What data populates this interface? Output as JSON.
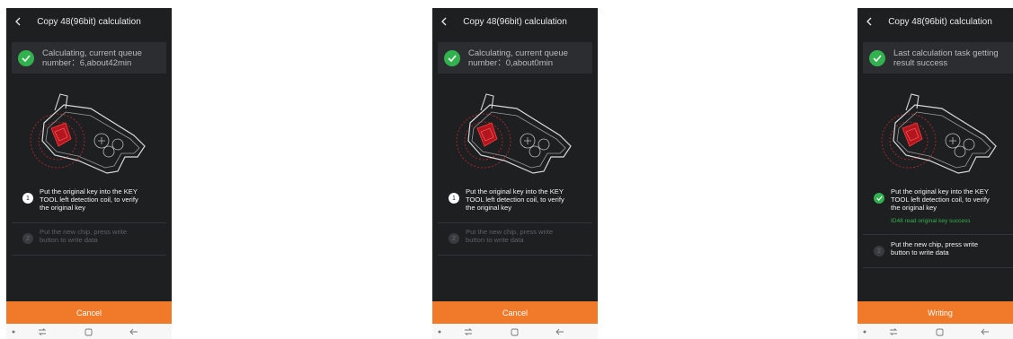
{
  "screens": [
    {
      "title": "Copy 48(96bit) calculation",
      "status": [
        "Calculating, current queue",
        "number：6,about42min"
      ],
      "steps": [
        {
          "num": "1",
          "lines": [
            "Put the original key into the KEY",
            "TOOL left detection coil, to verify",
            "the original key"
          ],
          "sub": ""
        },
        {
          "num": "2",
          "lines": [
            "Put the new chip, press write",
            "button to write data"
          ]
        }
      ],
      "button": "Cancel"
    },
    {
      "title": "Copy 48(96bit) calculation",
      "status": [
        "Calculating, current queue",
        "number：0,about0min"
      ],
      "steps": [
        {
          "num": "1",
          "lines": [
            "Put the original key into the KEY",
            "TOOL left detection coil, to verify",
            "the original key"
          ]
        },
        {
          "num": "2",
          "lines": [
            "Put the new chip, press write",
            "button to write data"
          ]
        }
      ],
      "button": "Cancel"
    },
    {
      "title": "Copy 48(96bit) calculation",
      "status": [
        "Last calculation task getting",
        "result success"
      ],
      "steps": [
        {
          "num": "",
          "lines": [
            "Put the original key into the KEY",
            "TOOL left detection coil, to verify",
            "the original key"
          ],
          "sub": "ID48 read original key success"
        },
        {
          "num": "2",
          "lines": [
            "Put the new chip, press write",
            "button to write data"
          ]
        }
      ],
      "button": "Writing"
    }
  ],
  "icons": {
    "back": "chevron-left-icon",
    "status": "check-circle-icon",
    "nav": [
      "dot-icon",
      "recent-apps-icon",
      "home-icon",
      "back-arrow-icon"
    ]
  },
  "colors": {
    "accent": "#f07a2a",
    "success": "#31b24e",
    "background": "#1e1f21"
  }
}
